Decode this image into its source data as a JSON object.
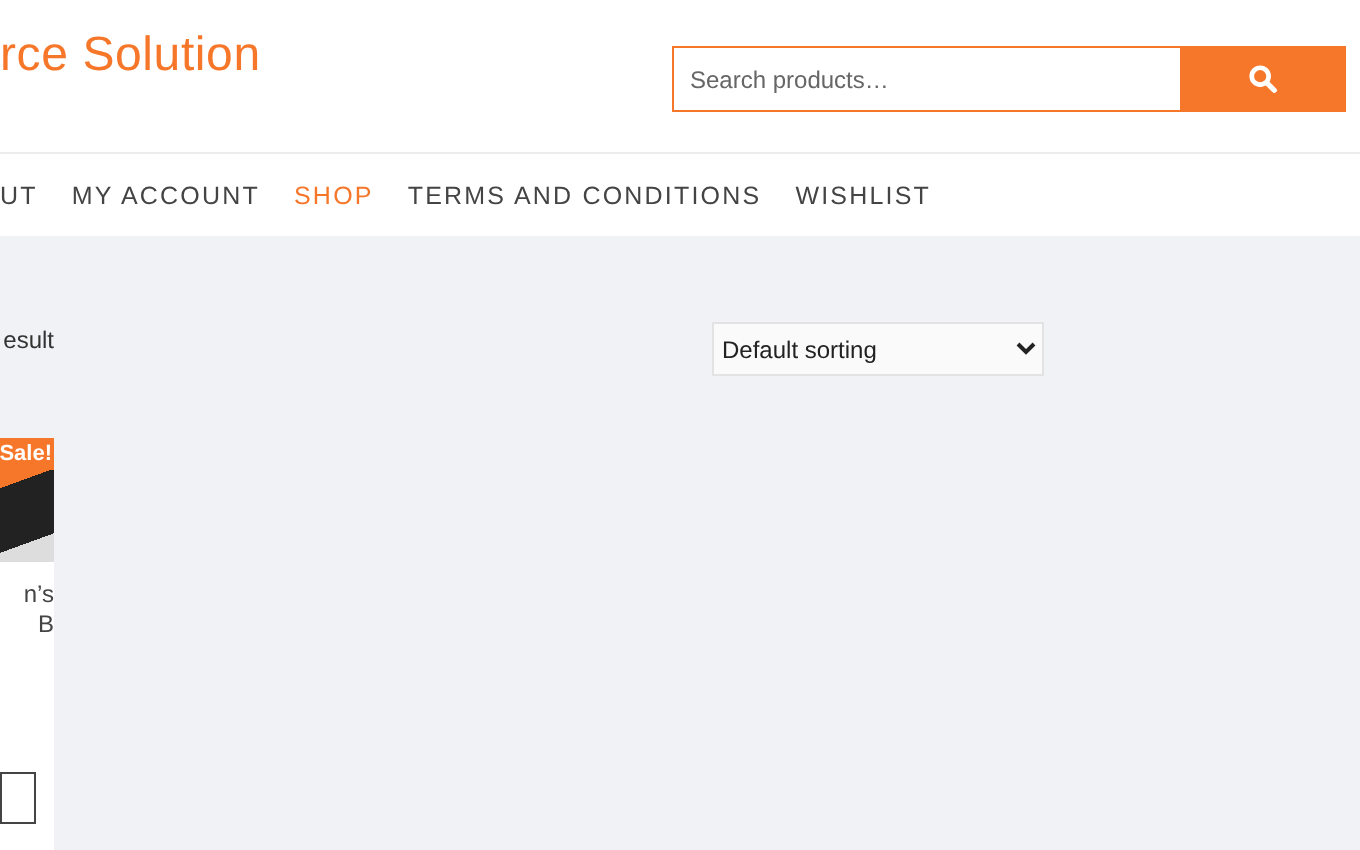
{
  "header": {
    "logo": "rce Solution",
    "search": {
      "placeholder": "Search products…"
    }
  },
  "nav": [
    {
      "label": "UT",
      "selected": false
    },
    {
      "label": "MY ACCOUNT",
      "selected": false
    },
    {
      "label": "SHOP",
      "selected": true
    },
    {
      "label": "TERMS AND CONDITIONS",
      "selected": false
    },
    {
      "label": "WISHLIST",
      "selected": false
    }
  ],
  "shop": {
    "result_count": "esult",
    "sorting": "Default sorting",
    "product": {
      "badge": "Sale!",
      "title_lines": [
        "n’s",
        "B"
      ]
    }
  }
}
